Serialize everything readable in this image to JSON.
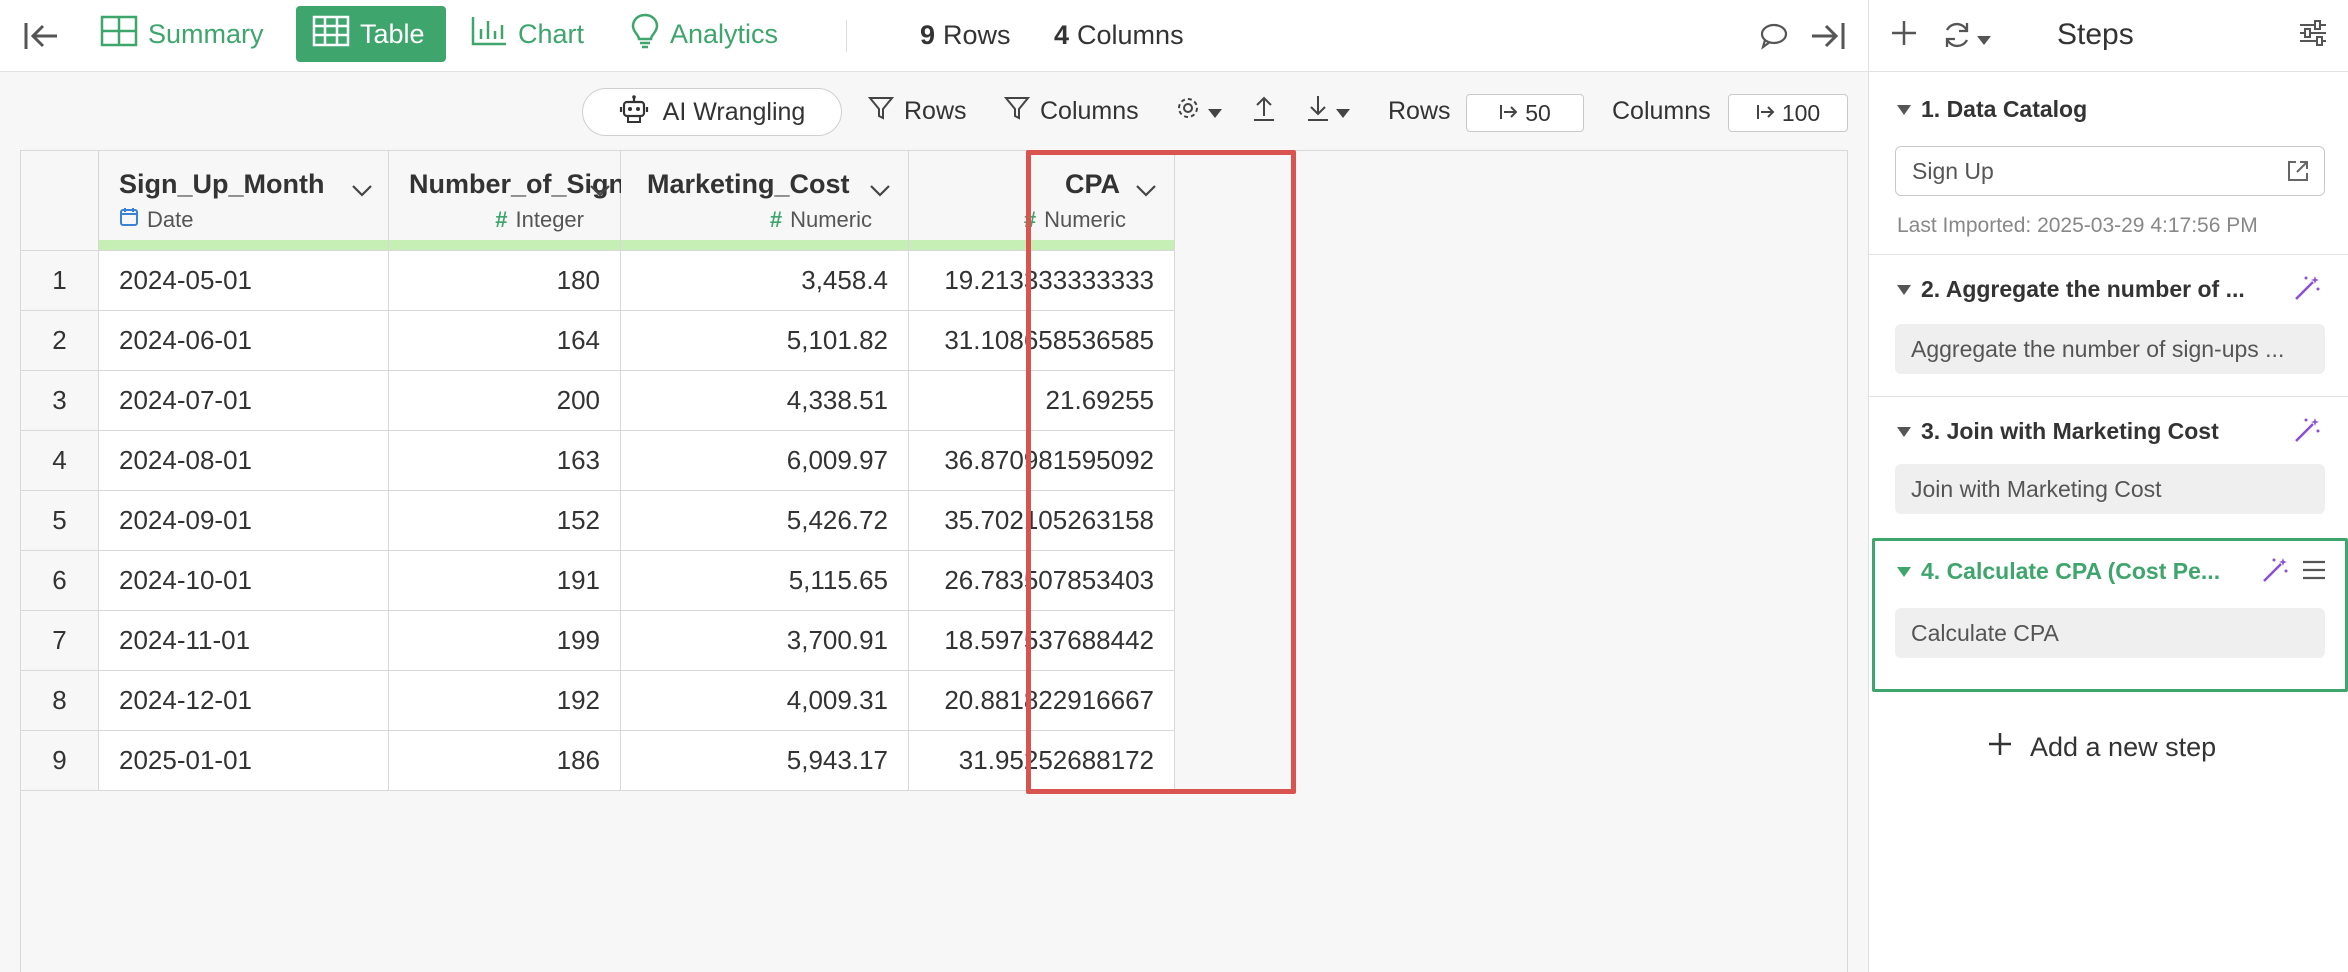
{
  "topbar": {
    "tabs": [
      {
        "label": "Summary",
        "icon": "summary-grid-icon"
      },
      {
        "label": "Table",
        "icon": "table-icon"
      },
      {
        "label": "Chart",
        "icon": "bar-chart-icon"
      },
      {
        "label": "Analytics",
        "icon": "lightbulb-icon"
      }
    ],
    "rows_count": "9",
    "rows_label": "Rows",
    "columns_count": "4",
    "columns_label": "Columns"
  },
  "toolbar": {
    "ai_label": "AI Wrangling",
    "rows_filter_label": "Rows",
    "columns_filter_label": "Columns",
    "rows_limit_label": "Rows",
    "rows_limit_value": "50",
    "columns_limit_label": "Columns",
    "columns_limit_value": "100"
  },
  "table": {
    "columns": [
      {
        "name": "Sign_Up_Month",
        "type": "Date"
      },
      {
        "name": "Number_of_Signups",
        "type": "Integer"
      },
      {
        "name": "Marketing_Cost",
        "type": "Numeric"
      },
      {
        "name": "CPA",
        "type": "Numeric"
      }
    ],
    "rows": [
      [
        "1",
        "2024-05-01",
        "180",
        "3,458.4",
        "19.213333333333"
      ],
      [
        "2",
        "2024-06-01",
        "164",
        "5,101.82",
        "31.108658536585"
      ],
      [
        "3",
        "2024-07-01",
        "200",
        "4,338.51",
        "21.69255"
      ],
      [
        "4",
        "2024-08-01",
        "163",
        "6,009.97",
        "36.870981595092"
      ],
      [
        "5",
        "2024-09-01",
        "152",
        "5,426.72",
        "35.702105263158"
      ],
      [
        "6",
        "2024-10-01",
        "191",
        "5,115.65",
        "26.783507853403"
      ],
      [
        "7",
        "2024-11-01",
        "199",
        "3,700.91",
        "18.597537688442"
      ],
      [
        "8",
        "2024-12-01",
        "192",
        "4,009.31",
        "20.881822916667"
      ],
      [
        "9",
        "2025-01-01",
        "186",
        "5,943.17",
        "31.95252688172"
      ]
    ]
  },
  "panel": {
    "title": "Steps",
    "steps": [
      {
        "title": "1. Data Catalog",
        "box": "Sign Up",
        "note": "Last Imported: 2025-03-29 4:17:56 PM"
      },
      {
        "title": "2. Aggregate the number of ...",
        "box": "Aggregate the number of sign-ups ..."
      },
      {
        "title": "3. Join with Marketing Cost",
        "box": "Join with Marketing Cost"
      },
      {
        "title": "4. Calculate CPA (Cost Pe...",
        "box": "Calculate CPA"
      }
    ],
    "add_step_label": "Add a new step"
  },
  "colors": {
    "accent_green": "#3ea56c",
    "highlight_red": "#d9534f",
    "type_bar": "#c6efb6",
    "ai_purple": "#8a4fd6",
    "date_blue": "#3b82d6"
  }
}
